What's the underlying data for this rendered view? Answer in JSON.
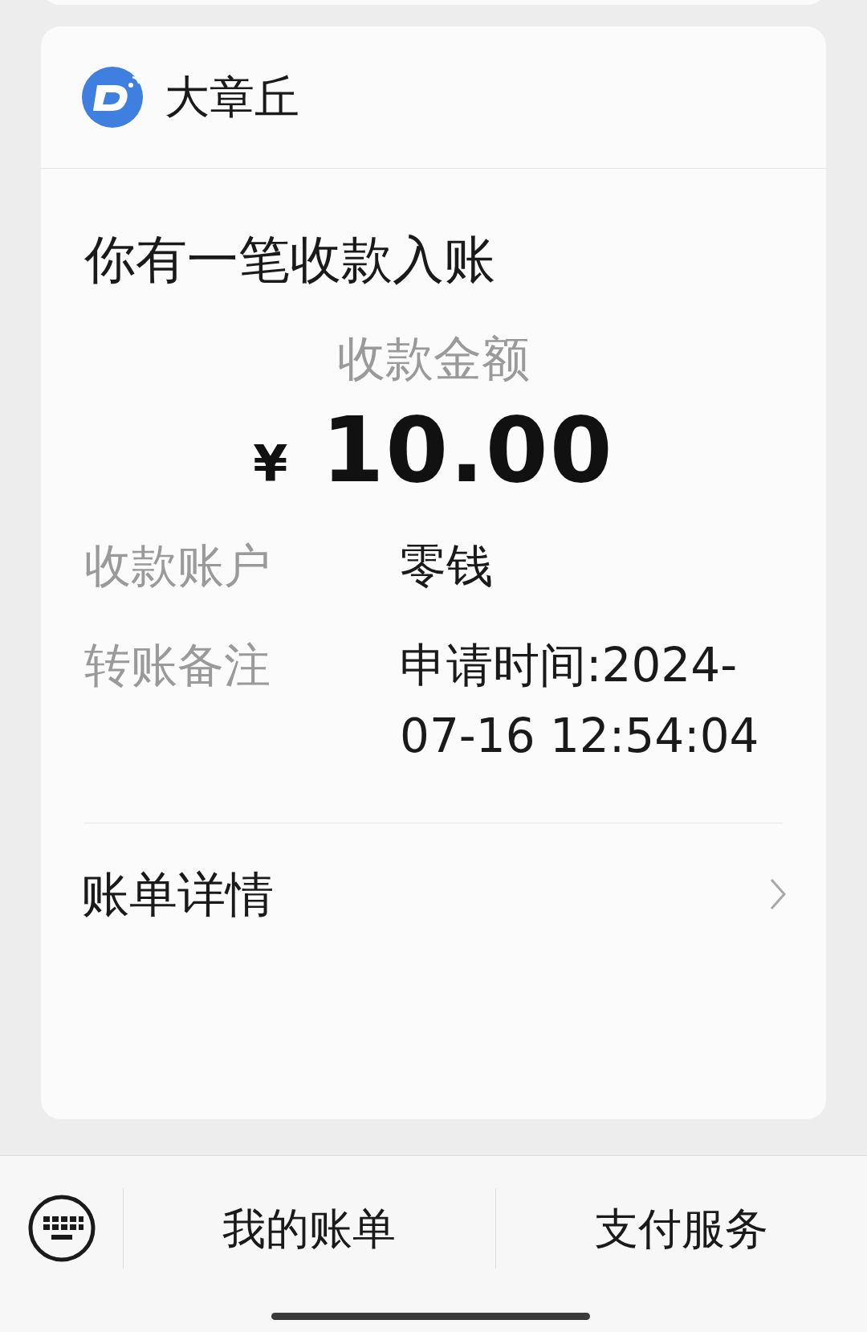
{
  "header": {
    "title": "大章丘"
  },
  "notice": {
    "heading": "你有一笔收款入账",
    "amount_label": "收款金额",
    "currency": "¥",
    "amount": "10.00",
    "details": [
      {
        "label": "收款账户",
        "value": "零钱"
      },
      {
        "label": "转账备注",
        "value": "申请时间:2024-07-16 12:54:04"
      }
    ],
    "link": "账单详情"
  },
  "bottom_menu": [
    "我的账单",
    "支付服务"
  ]
}
